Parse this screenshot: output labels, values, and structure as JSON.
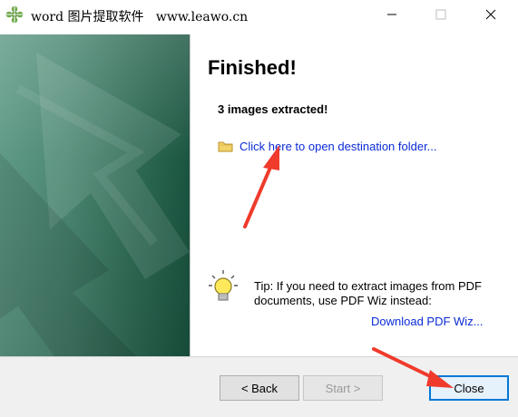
{
  "window": {
    "title": "word 图片提取软件   www.leawo.cn",
    "app_icon": "grid-app-icon",
    "controls": {
      "minimize_icon": "minimize-icon",
      "maximize_icon": "maximize-icon",
      "close_icon": "close-icon"
    }
  },
  "content": {
    "heading": "Finished!",
    "result": "3 images extracted!",
    "folder_link": {
      "icon": "folder-icon",
      "label": "Click here to open destination folder..."
    },
    "tip": {
      "icon": "lightbulb-icon",
      "text": "Tip: If you need to extract images from PDF documents, use PDF Wiz instead:"
    },
    "pdf_link": "Download PDF Wiz..."
  },
  "buttons": {
    "back": "< Back",
    "start": "Start >",
    "close": "Close"
  },
  "colors": {
    "link": "#0b2bd6",
    "banner": "#2f6b55",
    "annotation": "#f03a2b",
    "focus": "#0078d7"
  }
}
